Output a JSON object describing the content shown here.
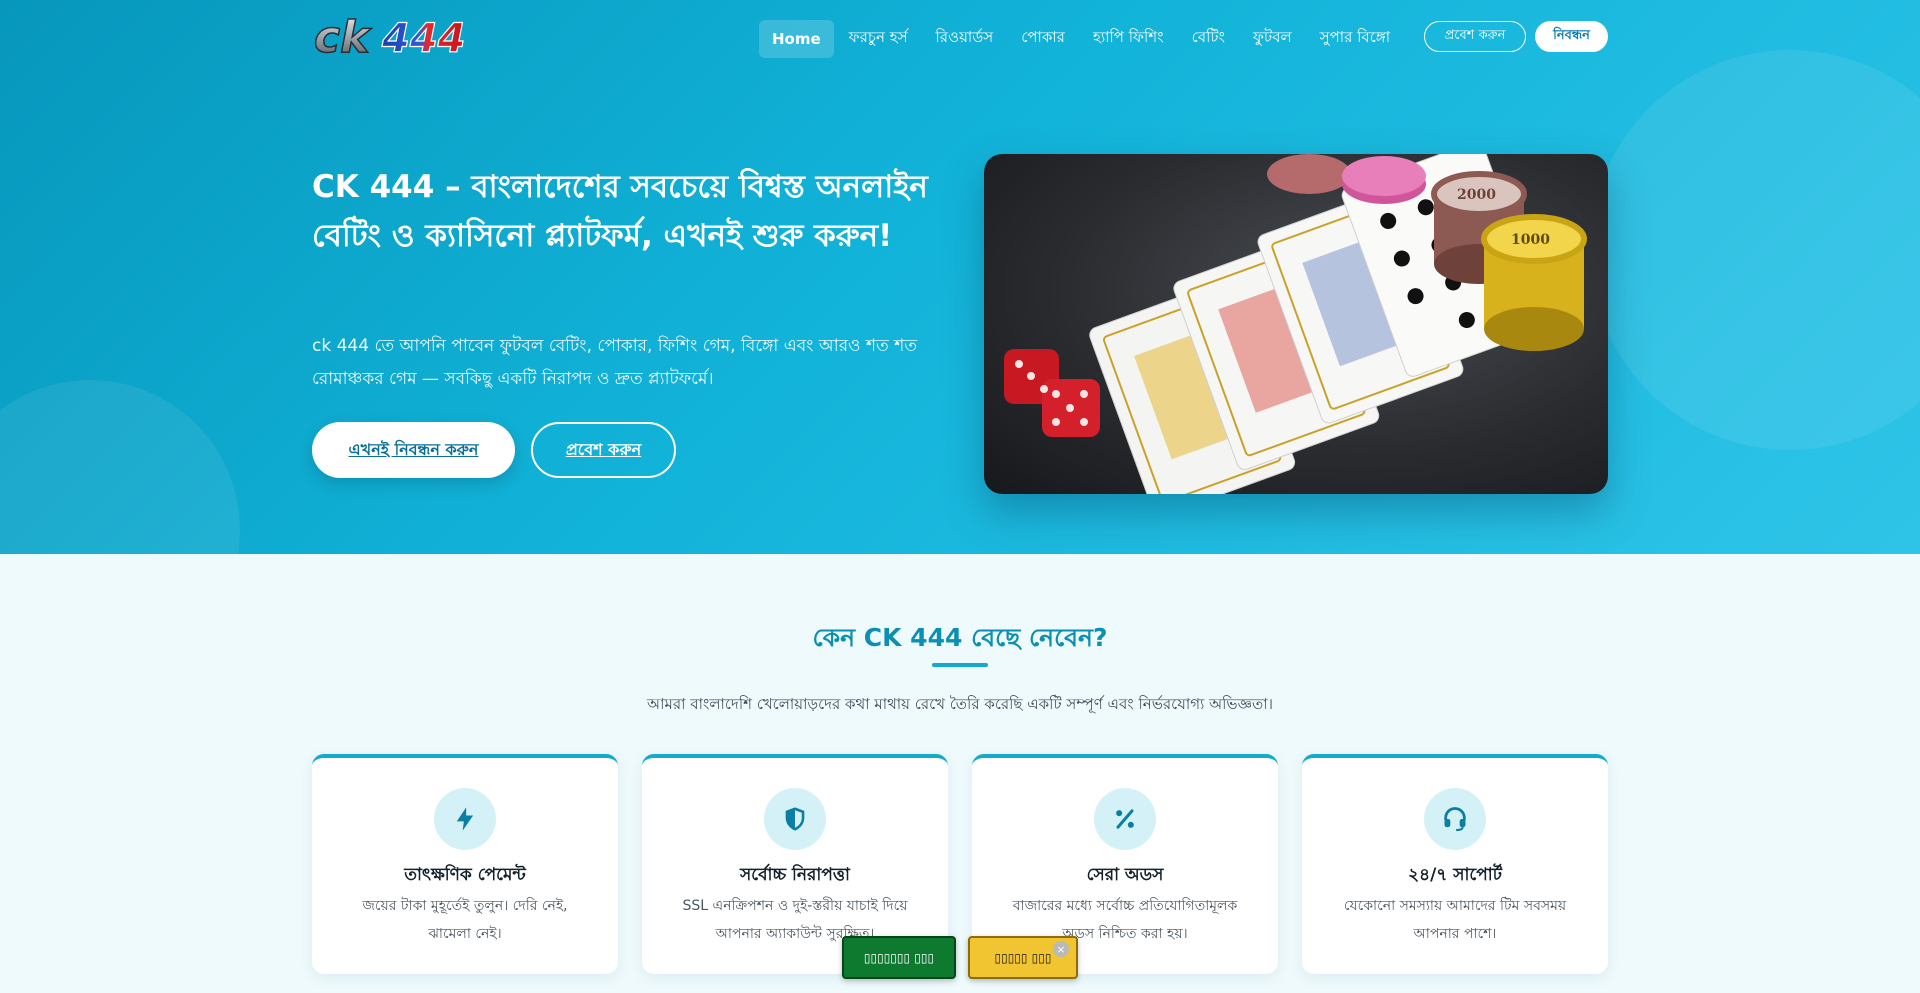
{
  "brand": {
    "logo_text": "ck444"
  },
  "nav": {
    "items": [
      {
        "label": "Home",
        "active": true
      },
      {
        "label": "ফরচুন হর্স",
        "active": false
      },
      {
        "label": "রিওয়ার্ডস",
        "active": false
      },
      {
        "label": "পোকার",
        "active": false
      },
      {
        "label": "হ্যাপি ফিশিং",
        "active": false
      },
      {
        "label": "বেটিং",
        "active": false
      },
      {
        "label": "ফুটবল",
        "active": false
      },
      {
        "label": "সুপার বিঙ্গো",
        "active": false
      }
    ],
    "login_label": "প্রবেশ করুন",
    "register_label": "নিবন্ধন"
  },
  "hero": {
    "title": "CK 444 – বাংলাদেশের সবচেয়ে বিশ্বস্ত অনলাইন বেটিং ও ক্যাসিনো প্ল্যাটফর্ম, এখনই শুরু করুন!",
    "description": "ck 444 তে আপনি পাবেন ফুটবল বেটিং, পোকার, ফিশিং গেম, বিঙ্গো এবং আরও শত শত রোমাঞ্চকর গেম — সবকিছু একটি নিরাপদ ও দ্রুত প্ল্যাটফর্মে।",
    "primary_button": "এখনই নিবন্ধন করুন",
    "secondary_button": "প্রবেশ করুন",
    "image_chip_labels": [
      "1000",
      "2000"
    ]
  },
  "features": {
    "title": "কেন CK 444 বেছে নেবেন?",
    "subtitle": "আমরা বাংলাদেশি খেলোয়াড়দের কথা মাথায় রেখে তৈরি করেছি একটি সম্পূর্ণ এবং নির্ভরযোগ্য অভিজ্ঞতা।",
    "cards": [
      {
        "icon": "lightning-icon",
        "title": "তাৎক্ষণিক পেমেন্ট",
        "desc": "জয়ের টাকা মুহূর্তেই তুলুন। দেরি নেই, ঝামেলা নেই।"
      },
      {
        "icon": "shield-icon",
        "title": "সর্বোচ্চ নিরাপত্তা",
        "desc": "SSL এনক্রিপশন ও দুই-স্তরীয় যাচাই দিয়ে আপনার অ্যাকাউন্ট সুরক্ষিত।"
      },
      {
        "icon": "percent-icon",
        "title": "সেরা অডস",
        "desc": "বাজারের মধ্যে সর্বোচ্চ প্রতিযোগিতামূলক অডস নিশ্চিত করা হয়।"
      },
      {
        "icon": "headset-icon",
        "title": "২৪/৭ সাপোর্ট",
        "desc": "যেকোনো সমস্যায় আমাদের টিম সবসময় আপনার পাশে।"
      }
    ]
  },
  "floating": {
    "green_label": "▯▯▯▯▯▯▯ ▯▯▯",
    "yellow_label": "▯▯▯▯▯ ▯▯▯",
    "close_label": "×"
  },
  "colors": {
    "hero_gradient_start": "#0797bc",
    "hero_gradient_end": "#2ec4e8",
    "accent": "#14a9cf",
    "float_green": "#0d7a30",
    "float_yellow": "#f0c531"
  }
}
